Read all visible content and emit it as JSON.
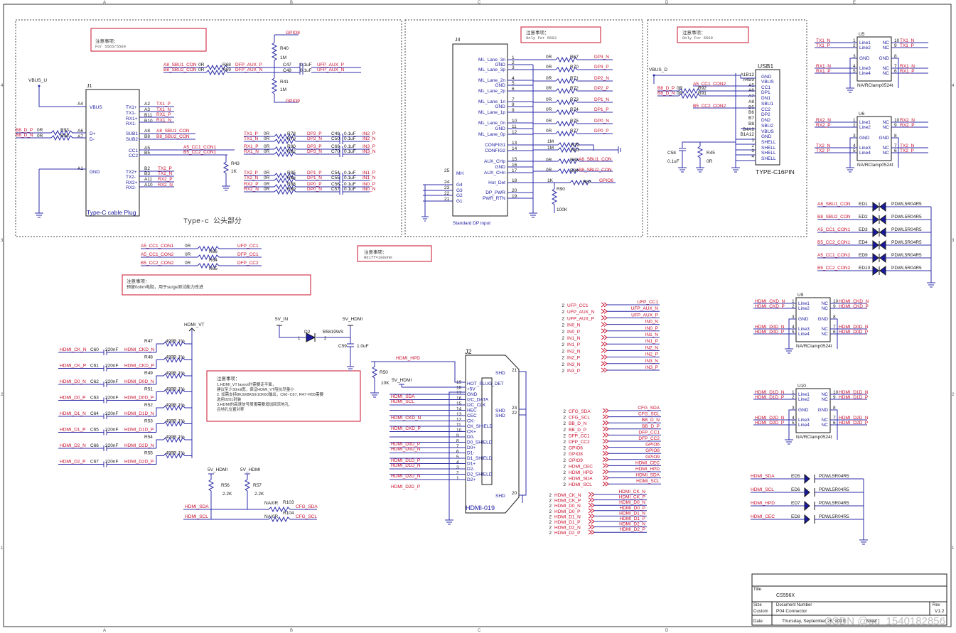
{
  "title_block": {
    "title_label": "Title",
    "title": "CS556X",
    "size_label": "Size",
    "size": "Custom",
    "docnum_label": "Document Number",
    "docnum": "P04 Connector",
    "rev_label": "Rev",
    "rev": "V1.2",
    "date_label": "Date:",
    "date": "Thursday, September 26, 2019",
    "sheet_label": "Sheet",
    "watermark": "CSDN @qq_1540182856"
  },
  "notes": {
    "typec_note_title": "注意事项：",
    "typec_note_body": "For 5565/5569",
    "dp_note_title": "注意事项：",
    "dp_note_body": "Only For 5563",
    "usb_note_title": "注意事项：",
    "usb_note_body": "Only For 5569",
    "rdiff_title": "注意事项：",
    "rdiff_body": "Rdiff=100ohm",
    "surge_title": "注意事项：",
    "surge_body": "预留0ohm电阻，用于surge测试能力改进",
    "hdmi_title": "注意事项：",
    "hdmi_l1": "1.HDMI_VT layout时需要走平面，",
    "hdmi_l2": "建议至少30mil宽，保证HDMI_VT阻抗尽量小",
    "hdmi_l3": "2. 如需支持8K30/8K60/10K60输出，C60~C67, R47~R55需要",
    "hdmi_l4": "选用0201封装",
    "hdmi_l5": "3.HDMI的高速信号周围需要增加回流地孔,",
    "hdmi_l6": "且地孔位置对称",
    "typec_plug_caption": "Type-c 公头部分"
  },
  "j1": {
    "ref": "J1",
    "name": "Type-C cable Plug",
    "vbus_net": "VBUS_U",
    "pins_left": [
      "VBUS",
      "D+",
      "D-",
      "GND"
    ],
    "pins_right": [
      "TX1+",
      "TX1-",
      "RX1+",
      "RX1-",
      "SUB1",
      "SUB2",
      "CC1",
      "CC2",
      "TX2+",
      "TX2-",
      "RX2+",
      "RX2-"
    ],
    "pin_nums": [
      "A4",
      "A6",
      "A7",
      "A1",
      "A2",
      "A3",
      "B11",
      "B10",
      "A8",
      "B8",
      "A5",
      "B5",
      "B2",
      "B3",
      "A11",
      "A10"
    ],
    "nets": [
      "TX1_P",
      "TX1_N",
      "RX1_P",
      "RX1_N",
      "A8_SBU1_CON",
      "B8_SBU2_CON",
      "A5_CC1_CON1",
      "B5_CC2_CON1",
      "TX2_P",
      "TX2_N",
      "RX2_P",
      "RX2_N",
      "B8_D_P",
      "B8_D_N"
    ],
    "r93": "R93",
    "r94": "R94",
    "zero": "0R"
  },
  "aux_block": {
    "gpio8": "GPIO8",
    "gpio9": "GPIO9",
    "r40": "R40",
    "r41": "R41",
    "v1m": "1M",
    "r68": "R68",
    "r69": "R69",
    "c47": "C47",
    "c48": "C48",
    "cap": "0.1uF",
    "sbu1": "A8_SBU1_CON",
    "sbu2": "B8_SBU2_CON",
    "dfp_aux_p": "DFP_AUX_P",
    "dfp_aux_n": "DFP_AUX_N",
    "ufp_aux_p": "UFP_AUX_P",
    "ufp_aux_n": "UFP_AUX_N"
  },
  "lane_block": {
    "rows": [
      {
        "in": "TX1_P",
        "r": "R78",
        "out": "DP2_P",
        "c": "C49",
        "o": "IN2_P"
      },
      {
        "in": "TX1_N",
        "r": "R79",
        "out": "DP2_N",
        "c": "C50",
        "o": "IN2_N"
      },
      {
        "in": "RX1_P",
        "r": "R80",
        "out": "DP3_P",
        "c": "C69",
        "o": "IN3_P"
      },
      {
        "in": "RX1_N",
        "r": "R82",
        "out": "DP3_N",
        "c": "C70",
        "o": "IN3_N"
      },
      {
        "in": "TX2_P",
        "r": "R85",
        "out": "DP1_P",
        "c": "C54",
        "o": "IN1_P"
      },
      {
        "in": "TX2_N",
        "r": "R86",
        "out": "DP1_N",
        "c": "C55",
        "o": "IN1_N"
      },
      {
        "in": "RX2_P",
        "r": "R88",
        "out": "DP0_P",
        "c": "C56",
        "o": "IN0_P"
      },
      {
        "in": "RX2_N",
        "r": "R89",
        "out": "DP0_N",
        "c": "C57",
        "o": "IN0_N"
      }
    ],
    "zero": "0R",
    "cap": "0.1uF",
    "cc1": "A5_CC1_CON1",
    "cc2": "B5_CC2_CON1",
    "r43": "R43",
    "r43v": "1K"
  },
  "cc_block": {
    "rows": [
      {
        "in": "A5_CC1_CON1",
        "r": "R66",
        "out": "UFP_CC1"
      },
      {
        "in": "A5_CC1_CON2",
        "r": "R64",
        "out": "DFP_CC1"
      },
      {
        "in": "B5_CC2_CON2",
        "r": "R65",
        "out": "DFP_CC2"
      }
    ],
    "zero": "0R"
  },
  "j3": {
    "ref": "J3",
    "name": "Standard DP input",
    "pins": [
      "ML_Lane_3n",
      "GND",
      "ML_Lane_3p",
      "ML_Lane_2n",
      "GND",
      "ML_Lane_2p",
      "ML_Lane_1n",
      "GND",
      "ML_Lane_1p",
      "ML_Lane_0n",
      "GND",
      "ML_Lane_0p",
      "CONFIG1",
      "CONFIG2",
      "AUX_CHp",
      "GND",
      "AUX_CHn",
      "Hot_Det",
      "DP_PWR",
      "PWR_RTN"
    ],
    "nums": [
      "1",
      "2",
      "3",
      "4",
      "5",
      "6",
      "7",
      "8",
      "9",
      "10",
      "11",
      "12",
      "13",
      "14",
      "15",
      "16",
      "17",
      "18",
      "20",
      "19"
    ],
    "left_pins": [
      "MH",
      "G4",
      "G3",
      "G2",
      "G1"
    ],
    "left_nums": [
      "25",
      "24",
      "23",
      "22",
      "21"
    ],
    "nets": [
      "DP3_N",
      "DP3_P",
      "DP2_N",
      "DP2_P",
      "DP1_N",
      "DP1_P",
      "DP0_N",
      "DP0_P"
    ],
    "rs": [
      "R67",
      "R70",
      "R71",
      "R72",
      "R73",
      "R74",
      "R75",
      "R77"
    ],
    "r79": "R79",
    "r81": "R81",
    "r83": "R83",
    "r84": "R84",
    "r87": "R87",
    "r90": "R90",
    "v1m": "1M",
    "zero": "0R",
    "v1k": "1K",
    "v100k": "100K",
    "sbu1": "A8_SBU1_CON",
    "sbu2": "B8_SBU2_CON",
    "gpio6": "GPIO6"
  },
  "usb1": {
    "ref": "USB1",
    "name": "TYPE-C16PIN",
    "vbus": "VBUS_D",
    "pins": [
      "GND",
      "VBUS",
      "CC1",
      "DP1",
      "DN1",
      "SBU1",
      "CC2",
      "DP2",
      "DN2",
      "SBU2",
      "VBUS",
      "GND",
      "SHELL",
      "SHELL",
      "SHELL",
      "SHELL"
    ],
    "nums": [
      "A1B12",
      "A4B9",
      "A5",
      "A6",
      "A7",
      "A8",
      "B5",
      "B6",
      "B7",
      "B8",
      "B4A9",
      "B1A12",
      "1",
      "2",
      "3",
      "4"
    ],
    "nets": [
      "A5_CC1_CON2",
      "B8_D_P",
      "B8_D_N",
      "B5_CC2_CON2"
    ],
    "r92": "R92",
    "r91": "R91",
    "zero": "0R",
    "c58": "C58",
    "c58v": "0.1uF",
    "r45": "R45",
    "r45v": "0R"
  },
  "esd_u5": {
    "ref": "U5",
    "part": "NA/RClamp0524t",
    "pins_l": [
      "Line1",
      "Line2",
      "GND",
      "Line3",
      "Line4"
    ],
    "nums_l": [
      "1",
      "2",
      "3",
      "4",
      "5"
    ],
    "nums_r": [
      "10",
      "9",
      "8",
      "7",
      "6"
    ],
    "nc": "NC",
    "gnd": "GND",
    "nets": [
      "TX1_N",
      "TX1_P",
      "RX1_N",
      "RX1_P"
    ]
  },
  "esd_u6": {
    "ref": "U6",
    "part": "NA/RClamp0524t",
    "nets": [
      "RX2_N",
      "RX2_P",
      "TX2_N",
      "TX2_P"
    ]
  },
  "esd_u9": {
    "ref": "U9",
    "part": "NA/RClamp0524t",
    "nets": [
      "HDMI_CKD_N",
      "HDMI_CKD_P",
      "HDMI_D0D_N",
      "HDMI_D0D_P"
    ]
  },
  "esd_u10": {
    "ref": "U10",
    "part": "NA/RClamp0524t",
    "nets": [
      "HDMI_D1D_N",
      "HDMI_D1D_P",
      "HDMI_D2D_N",
      "HDMI_D2D_P"
    ]
  },
  "tvs_top": {
    "part": "PDWL5R04R5",
    "rows": [
      {
        "net": "A8_SBU1_CON",
        "ref": "ED1"
      },
      {
        "net": "B8_SBU2_CON",
        "ref": "ED2"
      },
      {
        "net": "A5_CC1_CON1",
        "ref": "ED3"
      },
      {
        "net": "B5_CC2_CON1",
        "ref": "ED4"
      },
      {
        "net": "A5_CC1_CON2",
        "ref": "ED9"
      },
      {
        "net": "B5_CC2_CON2",
        "ref": "ED10"
      }
    ]
  },
  "tvs_bot": {
    "part": "PDWL5R04R5",
    "rows": [
      {
        "net": "HDMI_SDA",
        "ref": "ED5"
      },
      {
        "net": "HDMI_SCL",
        "ref": "ED6"
      },
      {
        "net": "HDMI_HPD",
        "ref": "ED7"
      },
      {
        "net": "HDMI_CEC",
        "ref": "ED8"
      }
    ]
  },
  "hdmi_term": {
    "vt": "HDMI_VT",
    "rows": [
      {
        "in": "HDMI_CK_N",
        "c": "C60",
        "r": "R47",
        "out": "HDMI_CKD_N"
      },
      {
        "in": "HDMI_CK_P",
        "c": "C61",
        "r": "R48",
        "out": "HDMI_CKD_P"
      },
      {
        "in": "HDMI_D0_N",
        "c": "C62",
        "r": "R49",
        "out": "HDMI_D0D_N"
      },
      {
        "in": "HDMI_D0_P",
        "c": "C63",
        "r": "R51",
        "out": "HDMI_D0D_P"
      },
      {
        "in": "HDMI_D1_N",
        "c": "C64",
        "r": "R52",
        "out": "HDMI_D1D_N"
      },
      {
        "in": "HDMI_D1_P",
        "c": "C65",
        "r": "R53",
        "out": "HDMI_D1D_P"
      },
      {
        "in": "HDMI_D2_N",
        "c": "C66",
        "r": "R54",
        "out": "HDMI_D2D_N"
      },
      {
        "in": "HDMI_D2_P",
        "c": "C67",
        "r": "R55",
        "out": "HDMI_D2D_P"
      }
    ],
    "cap": "220nF",
    "res": "499R 1%"
  },
  "power": {
    "v5in": "5V_IN",
    "v5hdmi": "5V_HDMI",
    "d2": "D2",
    "d2part": "B5819WS",
    "c59": "C59",
    "c59v": "1.0uF",
    "pin1": "1",
    "pin2": "2"
  },
  "i2c_block": {
    "v5": "5V_HDMI",
    "r56": "R56",
    "r57": "R57",
    "v22k": "2.2K",
    "r103": "R103",
    "r104": "R104",
    "na": "NA/0R",
    "sda": "HDMI_SDA",
    "scl": "HDMI_SCL",
    "cfg_sda": "CFG_SDA",
    "cfg_scl": "CFG_SCL"
  },
  "j2": {
    "ref": "J2",
    "name": "HDMI-019",
    "hpd": "HDMI_HPD",
    "v5": "5V_HDMI",
    "r50": "R50",
    "r50v": "10K",
    "pins": [
      "HOT_PLUG_DET",
      "+5V",
      "GND",
      "I2C_DATA",
      "I2C_CLK",
      "HEC",
      "CEC",
      "CK-",
      "CK_SHIELD",
      "CK+",
      "D0-",
      "D0_SHIELD",
      "D0+",
      "D1-",
      "D1_SHIELD",
      "D1+",
      "D2-",
      "D2_SHIELD",
      "D2+"
    ],
    "nums": [
      "19",
      "18",
      "17",
      "16",
      "15",
      "14",
      "13",
      "12",
      "11",
      "10",
      "9",
      "8",
      "7",
      "6",
      "5",
      "4",
      "3",
      "2",
      "1"
    ],
    "shd": "SHD",
    "shd_nums": [
      "21",
      "23",
      "22",
      "20"
    ],
    "nets": [
      "HDMI_SDA",
      "HDMI_SCL",
      "HDMI_CKD_N",
      "HDMI_CKD_P",
      "HDMI_D0D_P",
      "HDMI_D0D_N",
      "HDMI_D1D_P",
      "HDMI_D1D_N",
      "HDMI_D2D_N",
      "HDMI_D2D_P"
    ]
  },
  "offpage": {
    "left_cc": [
      {
        "n": "2",
        "net": "UFP_CC1"
      },
      {
        "n": "2",
        "net": "UFP_AUX_N"
      },
      {
        "n": "2",
        "net": "UFP_AUX_P"
      },
      {
        "n": "2",
        "net": "IN0_N"
      },
      {
        "n": "2",
        "net": "IN0_P"
      },
      {
        "n": "2",
        "net": "IN1_N"
      },
      {
        "n": "2",
        "net": "IN1_P"
      },
      {
        "n": "2",
        "net": "IN2_N"
      },
      {
        "n": "2",
        "net": "IN2_P"
      },
      {
        "n": "2",
        "net": "IN3_N"
      },
      {
        "n": "2",
        "net": "IN3_P"
      }
    ],
    "right_cc": [
      "UFP_CC1",
      "UFP_AUX_N",
      "UFP_AUX_P",
      "IN0_N",
      "IN0_P",
      "IN1_N",
      "IN1_P",
      "IN2_N",
      "IN2_P",
      "IN3_N",
      "IN3_P"
    ],
    "left_cfg": [
      {
        "n": "2",
        "net": "CFG_SDA"
      },
      {
        "n": "2",
        "net": "CFG_SCL"
      },
      {
        "n": "2",
        "net": "BB_D_N"
      },
      {
        "n": "2",
        "net": "BB_D_P"
      },
      {
        "n": "2",
        "net": "DFP_CC1"
      },
      {
        "n": "2",
        "net": "DFP_CC2"
      },
      {
        "n": "2",
        "net": "GPIO6"
      },
      {
        "n": "2",
        "net": "GPIO8"
      },
      {
        "n": "2",
        "net": "GPIO9"
      },
      {
        "n": "2",
        "net": "HDMI_CEC"
      },
      {
        "n": "2",
        "net": "HDMI_HPD"
      },
      {
        "n": "2",
        "net": "HDMI_SDA"
      },
      {
        "n": "2",
        "net": "HDMI_SCL"
      }
    ],
    "right_cfg": [
      "CFG_SDA",
      "CFG_SCL",
      "BB_D_N",
      "BB_D_P",
      "DFP_CC1",
      "DFP_CC2",
      "GPIO6",
      "GPIO8",
      "GPIO9",
      "HDMI_CEC",
      "HDMI_HPD",
      "HDMI_SDA",
      "HDMI_SCL"
    ],
    "left_hd": [
      {
        "n": "2",
        "net": "HDMI_CK_N"
      },
      {
        "n": "2",
        "net": "HDMI_CK_P"
      },
      {
        "n": "2",
        "net": "HDMI_D0_N"
      },
      {
        "n": "2",
        "net": "HDMI_D0_P"
      },
      {
        "n": "2",
        "net": "HDMI_D1_N"
      },
      {
        "n": "2",
        "net": "HDMI_D1_P"
      },
      {
        "n": "2",
        "net": "HDMI_D2_N"
      },
      {
        "n": "2",
        "net": "HDMI_D2_P"
      }
    ],
    "right_hd": [
      "HDMI_CK_N",
      "HDMI_CK_P",
      "HDMI_D0_N",
      "HDMI_D0_P",
      "HDMI_D1_N",
      "HDMI_D1_P",
      "HDMI_D2_N",
      "HDMI_D2_P"
    ]
  },
  "border": {
    "cols": [
      "A",
      "B",
      "C",
      "D",
      "E"
    ],
    "rows": [
      "4",
      "3",
      "2",
      "1"
    ]
  },
  "colors": {
    "wire": "#2c2ca8",
    "net": "#c8102e",
    "ink": "#1a1a1a",
    "part": "#1a1aa0",
    "note_border": "#c8102e",
    "dashed": "#444444"
  }
}
